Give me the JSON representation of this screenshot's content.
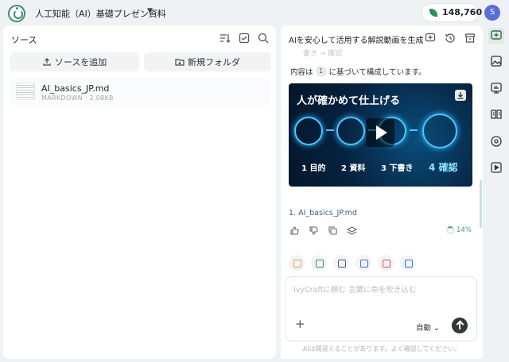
{
  "app": {
    "project_title": "人工知能（AI）基礎プレゼン資料",
    "credits": "148,760",
    "user_initial": "S"
  },
  "sources": {
    "title": "ソース",
    "add_source_label": "ソースを追加",
    "new_folder_label": "新規フォルダ",
    "files": [
      {
        "name": "AI_basics_JP.md",
        "meta": "MARKDOWN · 2.08KB"
      }
    ]
  },
  "chat": {
    "title": "AIを安心して活用する解説動画を生成",
    "cut_off_text": "書き → 確認",
    "based_prefix": "内容は",
    "citation_number": "1",
    "based_suffix": "に基づいて構成しています。",
    "video": {
      "headline": "人が確かめて仕上げる",
      "steps": [
        {
          "num": "1",
          "label": "目的"
        },
        {
          "num": "2",
          "label": "資料"
        },
        {
          "num": "3",
          "label": "下書き"
        },
        {
          "num": "4",
          "label": "確認"
        }
      ],
      "accent": "#49c8ff"
    },
    "source_reference": "1.  AI_basics_JP.md",
    "progress_percent": "14%",
    "composer": {
      "placeholder": "IvyCraftに頼む 言葉に命を吹き込む",
      "mode_label": "自動"
    },
    "disclaimer": "AIは間違えることがあります。よく確認してください。"
  },
  "colors": {
    "brand_green": "#3a8f6b",
    "avatar_bg": "#5a6cd8"
  }
}
